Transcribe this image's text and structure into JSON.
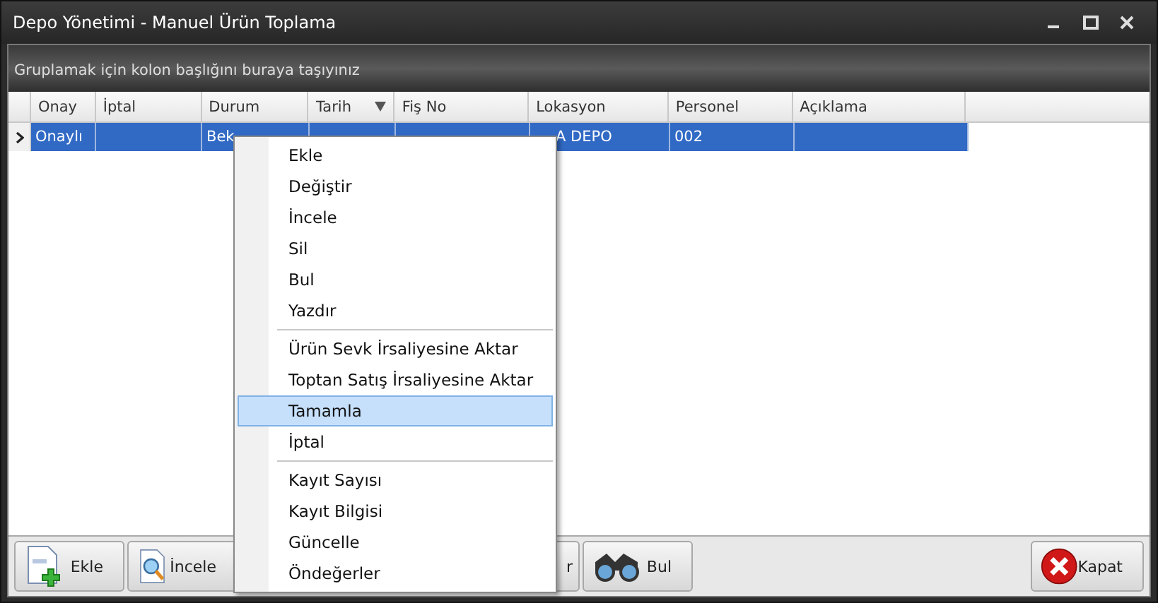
{
  "window": {
    "title": "Depo Yönetimi - Manuel Ürün Toplama"
  },
  "group_panel": {
    "hint": "Gruplamak için kolon başlığını buraya taşıyınız"
  },
  "table": {
    "columns": [
      {
        "label": "Onay",
        "sorted": false
      },
      {
        "label": "İptal",
        "sorted": false
      },
      {
        "label": "Durum",
        "sorted": false
      },
      {
        "label": "Tarih",
        "sorted": true
      },
      {
        "label": "Fiş No",
        "sorted": false
      },
      {
        "label": "Lokasyon",
        "sorted": false
      },
      {
        "label": "Personel",
        "sorted": false
      },
      {
        "label": "Açıklama",
        "sorted": false
      }
    ],
    "rows": [
      {
        "selected": true,
        "cells": [
          "Onaylı",
          "",
          "Bek",
          "",
          "",
          "A DEPO",
          "002",
          ""
        ]
      }
    ]
  },
  "context_menu": {
    "items": [
      {
        "kind": "item",
        "label": "Ekle",
        "selected": false
      },
      {
        "kind": "item",
        "label": "Değiştir",
        "selected": false
      },
      {
        "kind": "item",
        "label": "İncele",
        "selected": false
      },
      {
        "kind": "item",
        "label": "Sil",
        "selected": false
      },
      {
        "kind": "item",
        "label": "Bul",
        "selected": false
      },
      {
        "kind": "item",
        "label": "Yazdır",
        "selected": false
      },
      {
        "kind": "separator"
      },
      {
        "kind": "item",
        "label": "Ürün Sevk İrsaliyesine Aktar",
        "selected": false
      },
      {
        "kind": "item",
        "label": "Toptan Satış İrsaliyesine Aktar",
        "selected": false
      },
      {
        "kind": "item",
        "label": "Tamamla",
        "selected": true
      },
      {
        "kind": "item",
        "label": "İptal",
        "selected": false
      },
      {
        "kind": "separator"
      },
      {
        "kind": "item",
        "label": "Kayıt Sayısı",
        "selected": false
      },
      {
        "kind": "item",
        "label": "Kayıt Bilgisi",
        "selected": false
      },
      {
        "kind": "item",
        "label": "Güncelle",
        "selected": false
      },
      {
        "kind": "item",
        "label": "Öndeğerler",
        "selected": false
      }
    ]
  },
  "toolbar": {
    "buttons": [
      {
        "kind": "add",
        "label": "Ekle"
      },
      {
        "kind": "inspect",
        "label": "İncele"
      },
      {
        "kind": "hidden",
        "label": "r"
      },
      {
        "kind": "find",
        "label": "Bul"
      }
    ],
    "close": {
      "label": "Kapat"
    }
  }
}
